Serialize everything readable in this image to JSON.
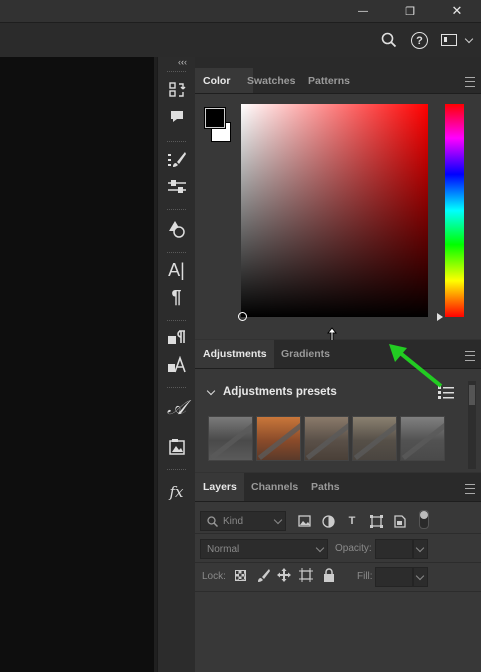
{
  "window": {
    "minimize_glyph": "—",
    "restore_glyph": "❐",
    "close_glyph": "✕"
  },
  "options_bar": {
    "search_icon": "search-icon",
    "help_glyph": "?",
    "workspace_icon": "workspace-icon"
  },
  "collapse_glyph": "‹‹",
  "tools": [
    {
      "name": "history-icon",
      "glyph": "⎘"
    },
    {
      "name": "comment-icon",
      "glyph": "▬"
    },
    {
      "name": "brush-settings-icon",
      "glyph": "✎"
    },
    {
      "name": "adjust-sliders-icon",
      "glyph": "⚌"
    },
    {
      "name": "shapes-icon",
      "glyph": "◭"
    },
    {
      "name": "character-icon",
      "glyph": "A|"
    },
    {
      "name": "paragraph-icon",
      "glyph": "¶"
    },
    {
      "name": "paragraph-styles-icon",
      "glyph": "¶"
    },
    {
      "name": "character-styles-icon",
      "glyph": "A"
    },
    {
      "name": "glyphs-icon",
      "glyph": "𝒜"
    },
    {
      "name": "libraries-icon",
      "glyph": "▤"
    },
    {
      "name": "fx-styles-icon",
      "glyph": "fx"
    }
  ],
  "color_panel": {
    "tabs": [
      "Color",
      "Swatches",
      "Patterns"
    ],
    "active_tab": "Color",
    "foreground_color": "#000000",
    "background_color": "#ffffff",
    "hue_color": "#ff0000"
  },
  "adjustments_panel": {
    "tabs": [
      "Adjustments",
      "Gradients"
    ],
    "active_tab": "Adjustments",
    "section_title": "Adjustments presets",
    "thumbnail_count": 5
  },
  "layers_panel": {
    "tabs": [
      "Layers",
      "Channels",
      "Paths"
    ],
    "active_tab": "Layers",
    "filter_placeholder": "Kind",
    "blend_mode": "Normal",
    "opacity_label": "Opacity:",
    "opacity_value": "",
    "lock_label": "Lock:",
    "fill_label": "Fill:",
    "fill_value": ""
  },
  "annotation": {
    "arrow_color": "#22cc22"
  }
}
